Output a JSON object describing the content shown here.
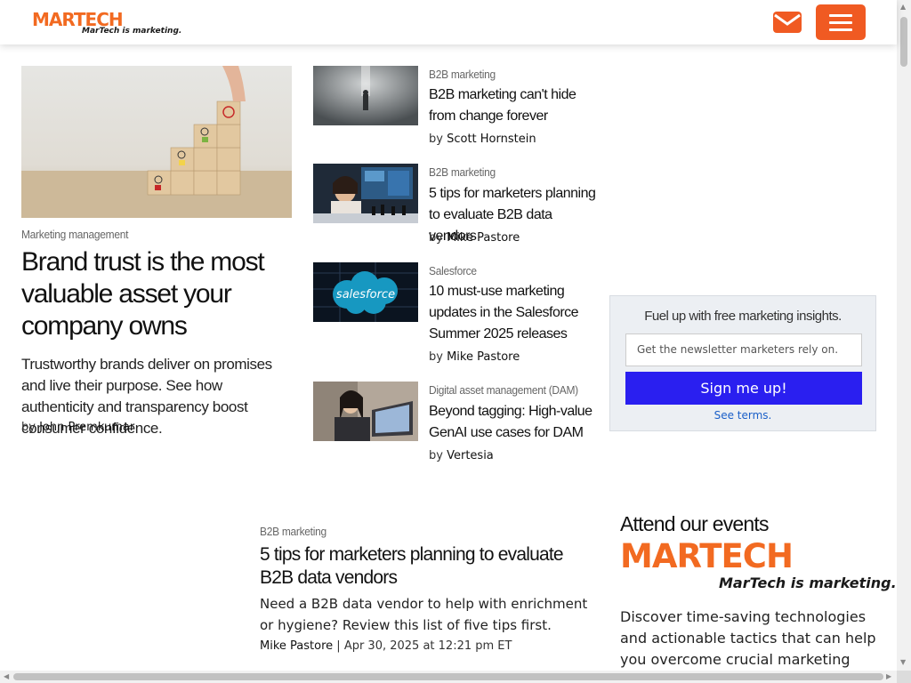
{
  "header": {
    "logo_text": "MARTECH",
    "logo_tagline": "MarTech is marketing.",
    "icons": {
      "mail": "envelope-icon",
      "menu": "hamburger-menu-icon"
    },
    "brand_color": "#f05a22"
  },
  "featured": {
    "category": "Marketing management",
    "title": "Brand trust is the most valuable asset your company owns",
    "description": "Trustworthy brands deliver on promises and live their purpose. See how authenticity and transparency boost consumer confidence.",
    "by_prefix": "by",
    "author": "John Premkumar"
  },
  "side_articles": [
    {
      "category": "B2B marketing",
      "title": "B2B marketing can't hide from change forever",
      "by_prefix": "by",
      "author": "Scott Hornstein"
    },
    {
      "category": "B2B marketing",
      "title": "5 tips for marketers planning to evaluate B2B data vendors",
      "by_prefix": "by",
      "author": "Mike Pastore"
    },
    {
      "category": "Salesforce",
      "title": "10 must-use marketing updates in the Salesforce Summer 2025 releases",
      "by_prefix": "by",
      "author": "Mike Pastore",
      "image_text": "salesforce"
    },
    {
      "category": "Digital asset management (DAM)",
      "title": "Beyond tagging: High-value GenAI use cases for DAM",
      "by_prefix": "by",
      "author": "Vertesia"
    }
  ],
  "newsletter": {
    "heading": "Fuel up with free marketing insights.",
    "placeholder": "Get the newsletter marketers rely on.",
    "button": "Sign me up!",
    "terms": "See terms.",
    "button_color": "#2a1ff0"
  },
  "lower_article": {
    "category": "B2B marketing",
    "title": "5 tips for marketers planning to evaluate B2B data vendors",
    "description": "Need a B2B data vendor to help with enrichment or hygiene? Review this list of five tips first.",
    "author": "Mike Pastore",
    "separator": "|",
    "date": "Apr 30, 2025 at 12:21 pm ET"
  },
  "events": {
    "heading": "Attend our events",
    "logo_text": "MARTECH",
    "logo_tagline": "MarTech is marketing.",
    "description": "Discover time-saving technologies and actionable tactics that can help you overcome crucial marketing challenges."
  }
}
